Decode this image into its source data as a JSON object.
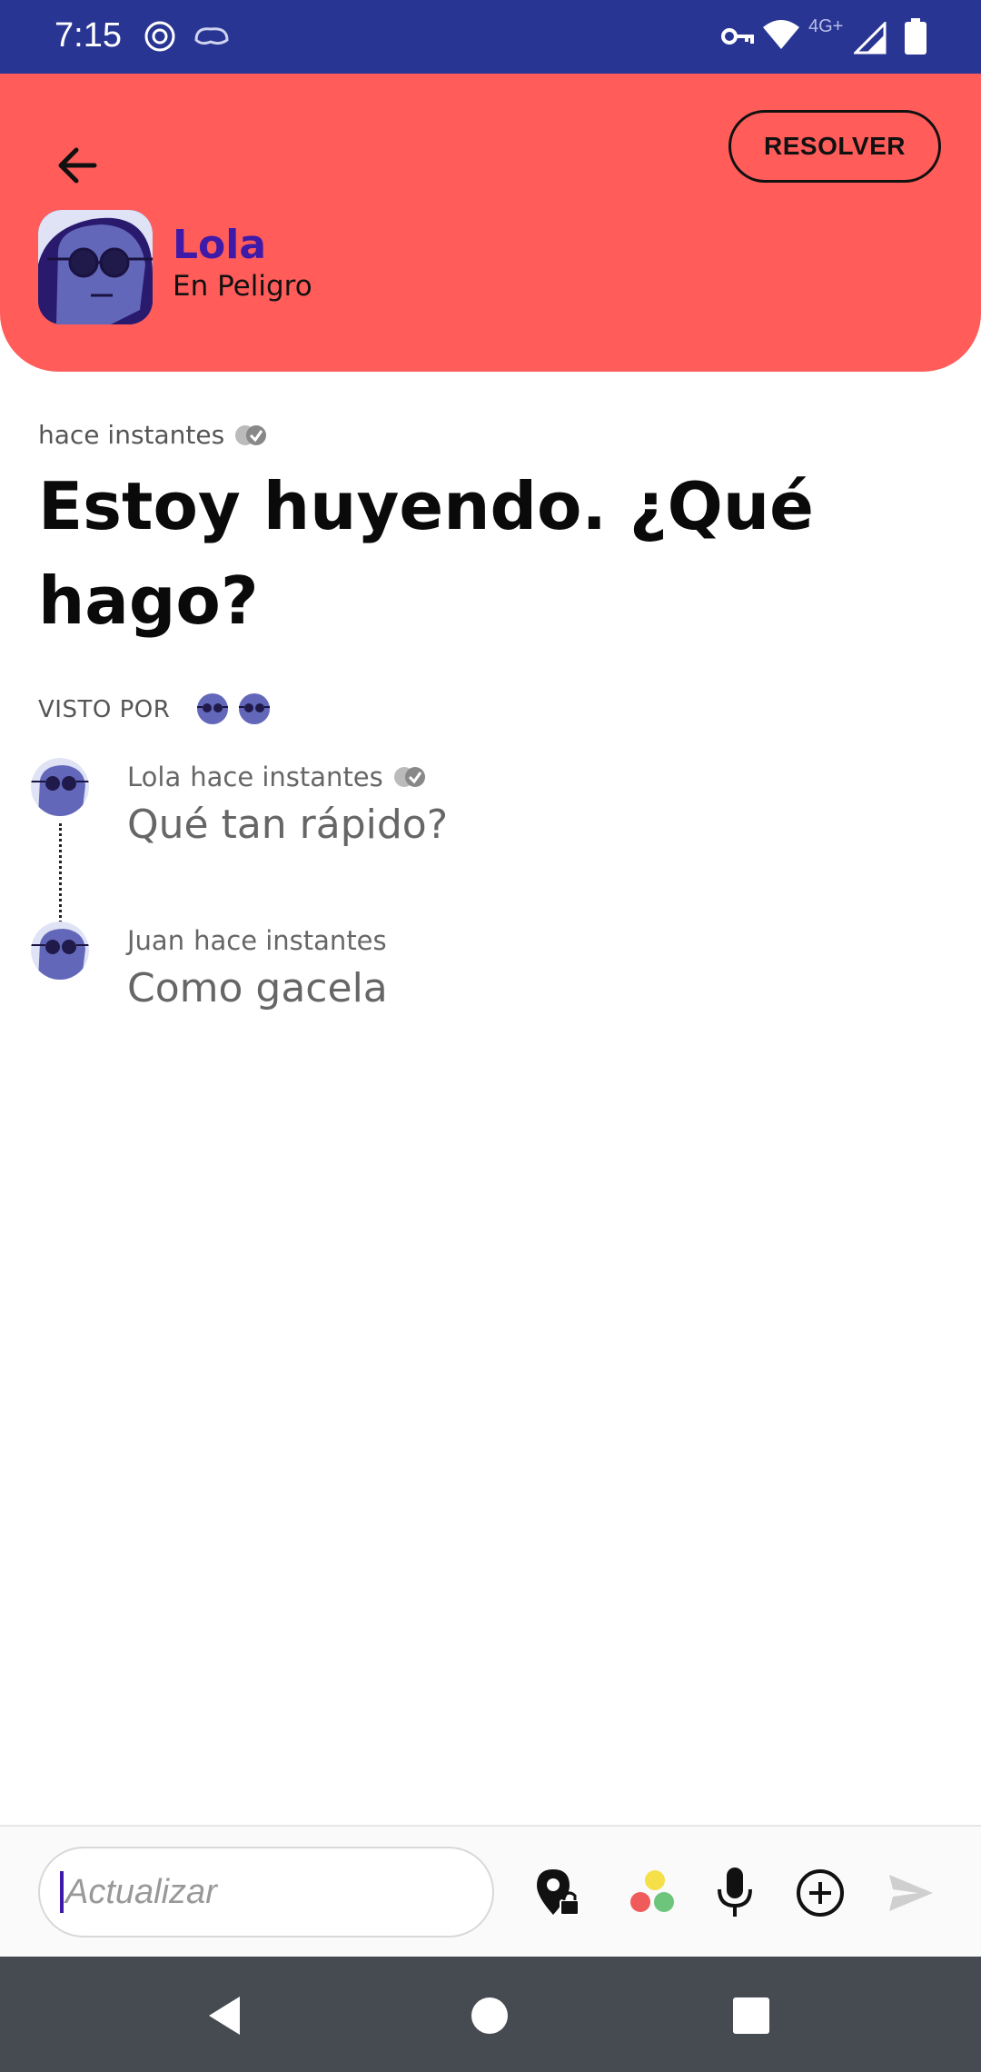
{
  "status_bar": {
    "time": "7:15",
    "network_label": "4G+",
    "icons": [
      "openai-icon",
      "brain-icon",
      "vpn-key-icon",
      "wifi-icon",
      "signal-icon",
      "battery-icon"
    ]
  },
  "header": {
    "back_icon": "arrow-left-icon",
    "resolve_label": "RESOLVER",
    "user_name": "Lola",
    "user_status": "En Peligro",
    "background_color": "#ff5c5a",
    "name_color": "#3f1aa8"
  },
  "message": {
    "time": "hace instantes",
    "text": "Estoy huyendo.  ¿Qué hago?",
    "seen_label": "VISTO POR"
  },
  "replies": [
    {
      "author": "Lola",
      "time": "hace instantes",
      "text": "Qué tan rápido?"
    },
    {
      "author": "Juan",
      "time": "hace instantes",
      "text": "Como gacela"
    }
  ],
  "composer": {
    "placeholder": "Actualizar",
    "icons": [
      "location-lock-icon",
      "colors-icon",
      "microphone-icon",
      "add-circle-icon",
      "send-icon"
    ]
  },
  "nav": {
    "icons": [
      "back-triangle-icon",
      "home-circle-icon",
      "recents-square-icon"
    ]
  }
}
